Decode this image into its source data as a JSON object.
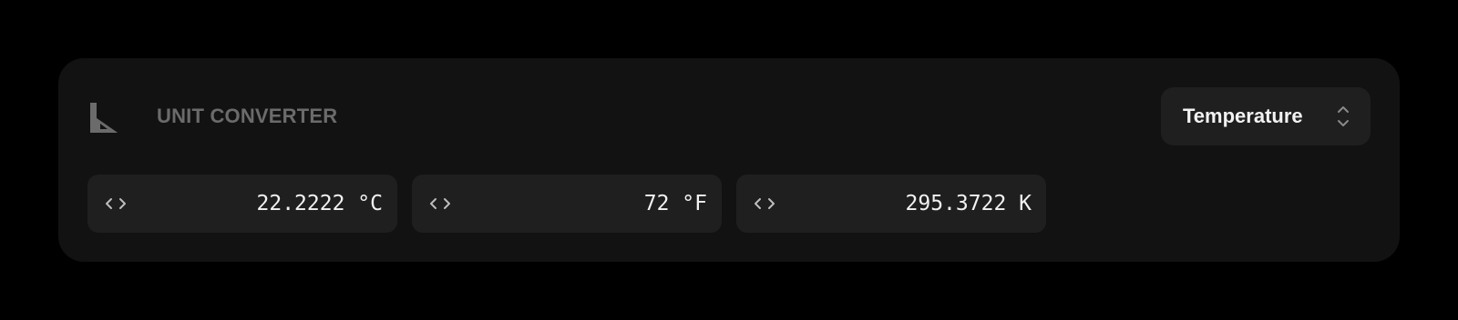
{
  "header": {
    "title": "UNIT CONVERTER",
    "icon": "ruler-triangle-icon"
  },
  "unit_select": {
    "selected": "Temperature",
    "icon": "chevron-up-down-icon"
  },
  "fields": [
    {
      "value": "22.2222 °C",
      "icon": "code-brackets-icon"
    },
    {
      "value": "72 °F",
      "icon": "code-brackets-icon"
    },
    {
      "value": "295.3722 K",
      "icon": "code-brackets-icon"
    }
  ],
  "colors": {
    "page_background": "#000000",
    "card_background": "#121212",
    "control_background": "#1f1f1f",
    "muted_text": "#6b6b6b",
    "primary_text": "#f2f2f2"
  }
}
